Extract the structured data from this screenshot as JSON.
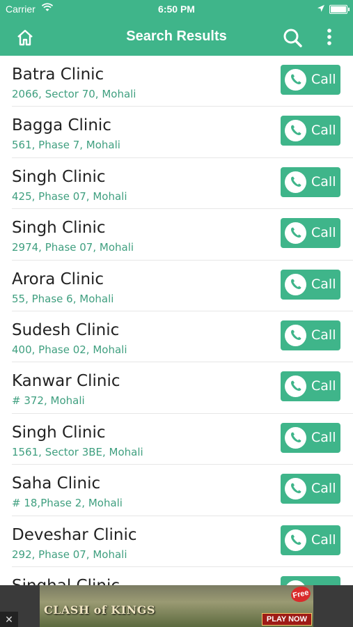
{
  "status": {
    "carrier": "Carrier",
    "time": "6:50 PM"
  },
  "header": {
    "title": "Search Results"
  },
  "call_label": "Call",
  "clinics": [
    {
      "name": "Batra Clinic",
      "address": "2066, Sector 70, Mohali"
    },
    {
      "name": "Bagga Clinic",
      "address": "561, Phase 7, Mohali"
    },
    {
      "name": "Singh Clinic",
      "address": "425, Phase 07, Mohali"
    },
    {
      "name": "Singh Clinic",
      "address": "2974, Phase 07, Mohali"
    },
    {
      "name": "Arora Clinic",
      "address": "55, Phase 6, Mohali"
    },
    {
      "name": "Sudesh Clinic",
      "address": "400, Phase 02, Mohali"
    },
    {
      "name": "Kanwar Clinic",
      "address": "# 372, Mohali"
    },
    {
      "name": "Singh Clinic",
      "address": "1561, Sector 3BE, Mohali"
    },
    {
      "name": "Saha Clinic",
      "address": "# 18,Phase 2, Mohali"
    },
    {
      "name": "Deveshar Clinic",
      "address": "292, Phase 07, Mohali"
    },
    {
      "name": "Singhal Clinic",
      "address": ""
    }
  ],
  "ad": {
    "close_label": "✕",
    "title": "CLASH of KINGS",
    "badge": "Free",
    "cta": "PLAY NOW"
  },
  "colors": {
    "brand": "#3fb58a",
    "address": "#3f9f7f"
  }
}
